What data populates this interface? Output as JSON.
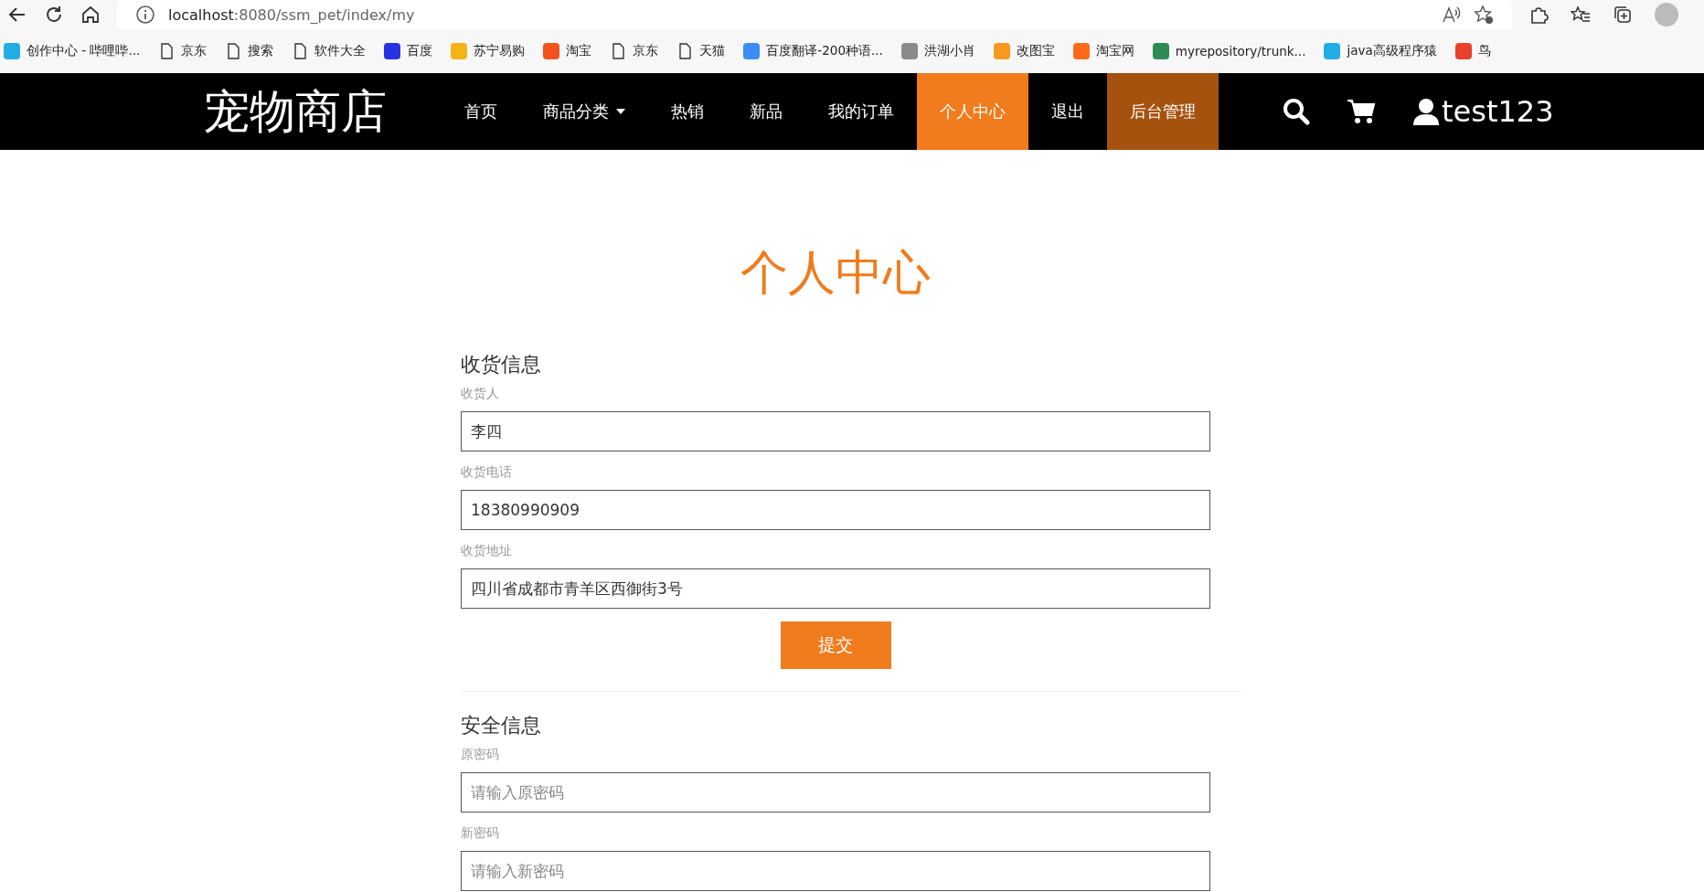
{
  "browser": {
    "address": {
      "host": "localhost",
      "rest": ":8080/ssm_pet/index/my"
    },
    "bookmarks": [
      {
        "label": "创作中心 - 哔哩哔...",
        "kind": "favicon",
        "color": "#23ade5"
      },
      {
        "label": "京东",
        "kind": "page"
      },
      {
        "label": "搜索",
        "kind": "page"
      },
      {
        "label": "软件大全",
        "kind": "page"
      },
      {
        "label": "百度",
        "kind": "favicon",
        "color": "#2932e1"
      },
      {
        "label": "苏宁易购",
        "kind": "favicon",
        "color": "#f5b316"
      },
      {
        "label": "淘宝",
        "kind": "favicon",
        "color": "#f4511e"
      },
      {
        "label": "京东",
        "kind": "page"
      },
      {
        "label": "天猫",
        "kind": "page"
      },
      {
        "label": "百度翻译-200种语...",
        "kind": "favicon",
        "color": "#3b8cf5"
      },
      {
        "label": "洪湖小肖",
        "kind": "favicon",
        "color": "#8a8a8a"
      },
      {
        "label": "改图宝",
        "kind": "favicon",
        "color": "#f79a1e"
      },
      {
        "label": "淘宝网",
        "kind": "favicon",
        "color": "#ff6a1a"
      },
      {
        "label": "myrepository/trunk...",
        "kind": "favicon",
        "color": "#2e8b57"
      },
      {
        "label": "java高级程序猿",
        "kind": "favicon",
        "color": "#23ade5"
      },
      {
        "label": "鸟",
        "kind": "favicon",
        "color": "#e8412c"
      }
    ]
  },
  "navbar": {
    "logo": "宠物商店",
    "items": [
      {
        "label": "首页",
        "selected": false,
        "kind": "link"
      },
      {
        "label": "商品分类",
        "selected": false,
        "kind": "dropdown"
      },
      {
        "label": "热销",
        "selected": false,
        "kind": "link"
      },
      {
        "label": "新品",
        "selected": false,
        "kind": "link"
      },
      {
        "label": "我的订单",
        "selected": false,
        "kind": "link"
      },
      {
        "label": "个人中心",
        "selected": true,
        "kind": "link"
      },
      {
        "label": "退出",
        "selected": false,
        "kind": "link"
      },
      {
        "label": "后台管理",
        "selected": false,
        "kind": "admin"
      }
    ],
    "username": "test123"
  },
  "page": {
    "title": "个人中心",
    "sections": [
      {
        "heading": "收货信息",
        "fields": [
          {
            "label": "收货人",
            "value": "李四"
          },
          {
            "label": "收货电话",
            "value": "18380990909"
          },
          {
            "label": "收货地址",
            "value": "四川省成都市青羊区西御街3号"
          }
        ],
        "button": "提交"
      },
      {
        "heading": "安全信息",
        "fields": [
          {
            "label": "原密码",
            "placeholder": "请输入原密码"
          },
          {
            "label": "新密码",
            "placeholder": "请输入新密码"
          }
        ]
      }
    ]
  }
}
